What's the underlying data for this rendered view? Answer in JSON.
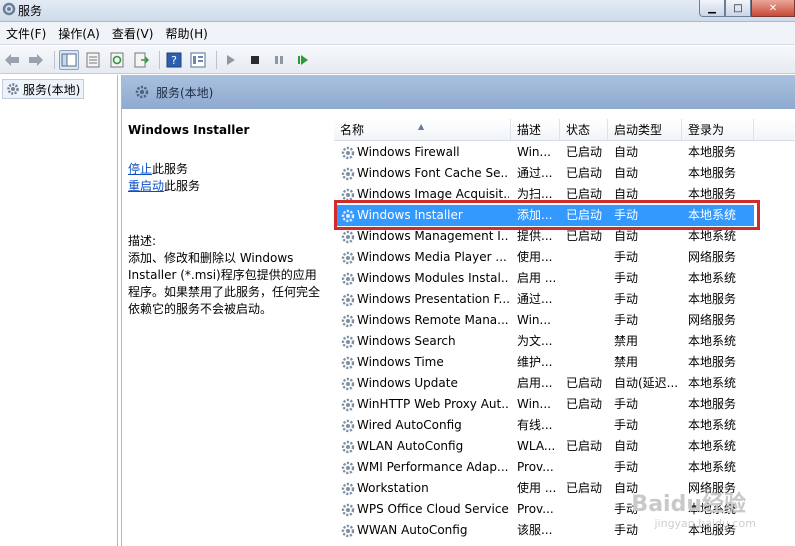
{
  "window": {
    "title": "服务"
  },
  "menu": [
    "文件(F)",
    "操作(A)",
    "查看(V)",
    "帮助(H)"
  ],
  "tree": {
    "root_label": "服务(本地)"
  },
  "pane": {
    "header": "服务(本地)"
  },
  "details": {
    "service_name": "Windows Installer",
    "stop_link": "停止",
    "stop_suffix": "此服务",
    "restart_link": "重启动",
    "restart_suffix": "此服务",
    "desc_label": "描述:",
    "desc_text": "添加、修改和删除以 Windows Installer (*.msi)程序包提供的应用程序。如果禁用了此服务，任何完全依赖它的服务不会被启动。"
  },
  "list": {
    "columns": [
      "名称",
      "描述",
      "状态",
      "启动类型",
      "登录为"
    ],
    "rows": [
      [
        "Windows Firewall",
        "Win...",
        "已启动",
        "自动",
        "本地服务"
      ],
      [
        "Windows Font Cache Se...",
        "通过...",
        "已启动",
        "自动",
        "本地服务"
      ],
      [
        "Windows Image Acquisit...",
        "为扫...",
        "已启动",
        "自动",
        "本地服务"
      ],
      [
        "Windows Installer",
        "添加...",
        "已启动",
        "手动",
        "本地系统"
      ],
      [
        "Windows Management I...",
        "提供...",
        "已启动",
        "自动",
        "本地系统"
      ],
      [
        "Windows Media Player ...",
        "使用...",
        "",
        "手动",
        "网络服务"
      ],
      [
        "Windows Modules Instal...",
        "启用 ...",
        "",
        "手动",
        "本地系统"
      ],
      [
        "Windows Presentation F...",
        "通过...",
        "",
        "手动",
        "本地服务"
      ],
      [
        "Windows Remote Mana...",
        "Win...",
        "",
        "手动",
        "网络服务"
      ],
      [
        "Windows Search",
        "为文...",
        "",
        "禁用",
        "本地系统"
      ],
      [
        "Windows Time",
        "维护...",
        "",
        "禁用",
        "本地服务"
      ],
      [
        "Windows Update",
        "启用...",
        "已启动",
        "自动(延迟...",
        "本地系统"
      ],
      [
        "WinHTTP Web Proxy Aut...",
        "Win...",
        "已启动",
        "手动",
        "本地服务"
      ],
      [
        "Wired AutoConfig",
        "有线...",
        "",
        "手动",
        "本地系统"
      ],
      [
        "WLAN AutoConfig",
        "WLA...",
        "已启动",
        "自动",
        "本地系统"
      ],
      [
        "WMI Performance Adap...",
        "Prov...",
        "",
        "手动",
        "本地系统"
      ],
      [
        "Workstation",
        "使用 ...",
        "已启动",
        "自动",
        "网络服务"
      ],
      [
        "WPS Office Cloud Service",
        "Prov...",
        "",
        "手动",
        "本地系统"
      ],
      [
        "WWAN AutoConfig",
        "该服...",
        "",
        "手动",
        "本地服务"
      ]
    ],
    "selected_index": 3
  },
  "watermark": {
    "line1": "Baidu经验",
    "line2": "jingyan.baidu.com"
  },
  "colors": {
    "selection": "#3399ff",
    "highlight_box": "#d12a2a",
    "header_bg": "#a9c1df"
  }
}
